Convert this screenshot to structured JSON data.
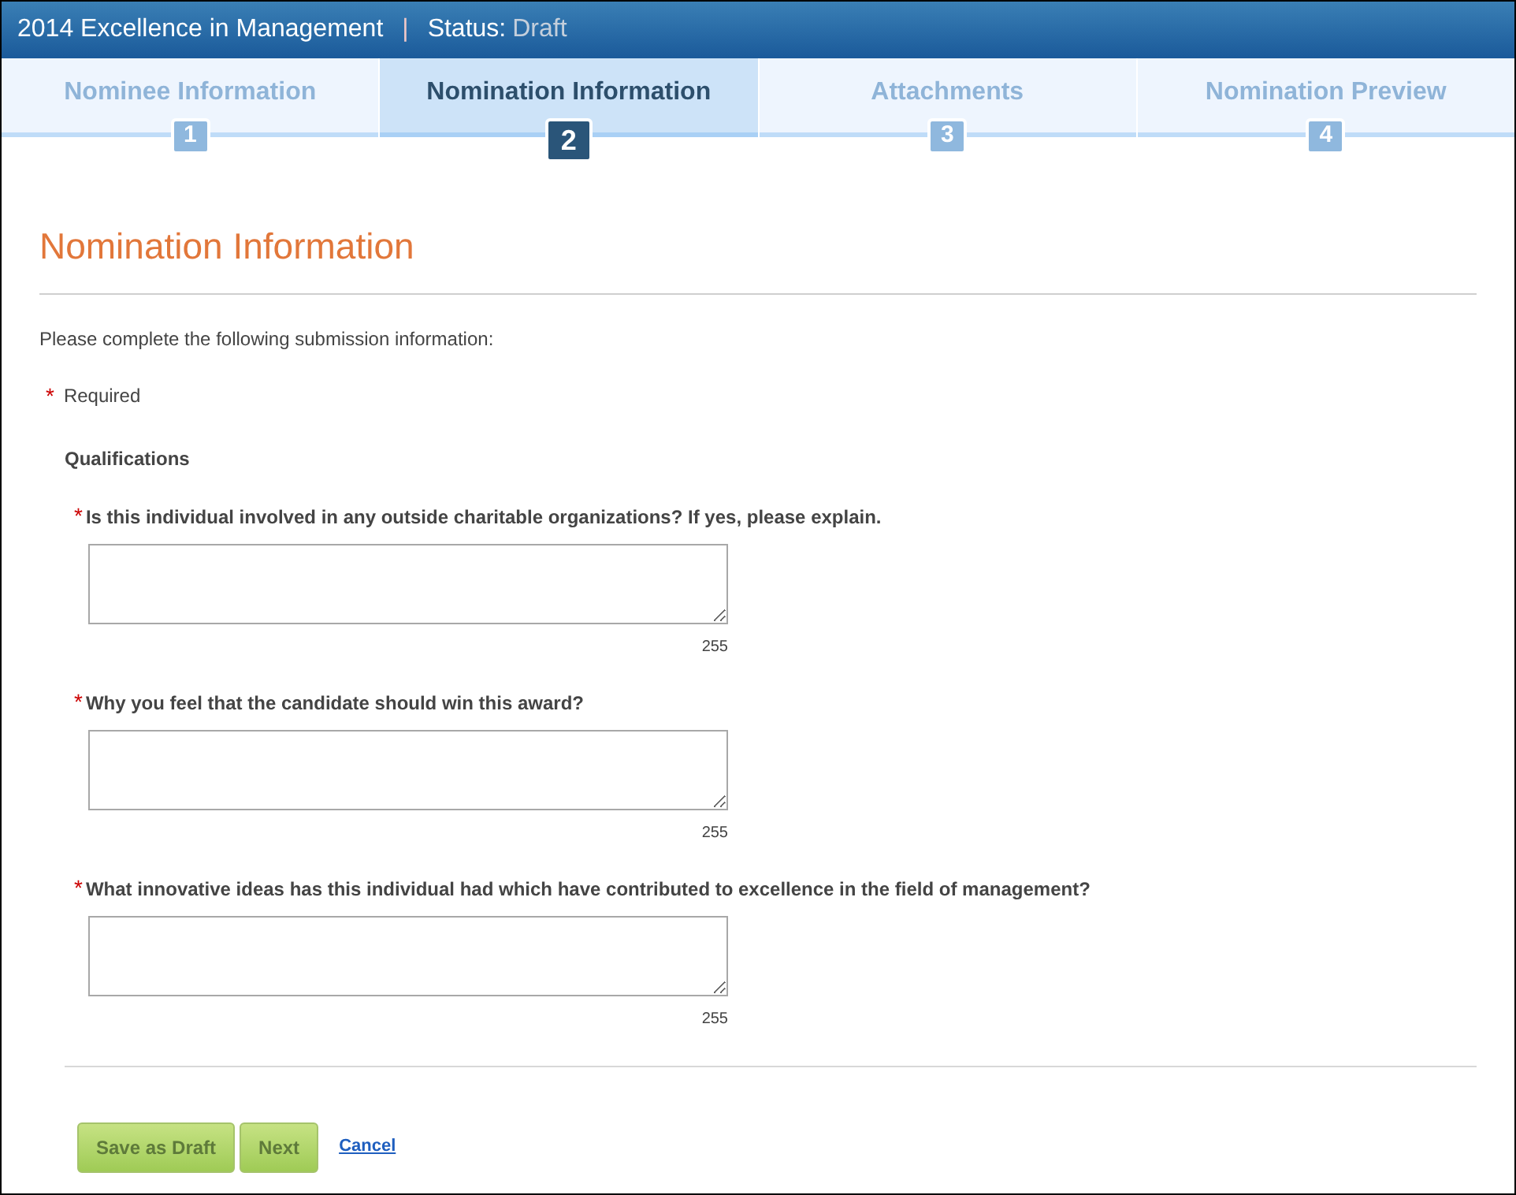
{
  "header": {
    "title": "2014 Excellence in Management",
    "separator": "|",
    "status_label": "Status:",
    "status_value": "Draft"
  },
  "steps": [
    {
      "label": "Nominee Information",
      "number": "1",
      "selected": false
    },
    {
      "label": "Nomination Information",
      "number": "2",
      "selected": true
    },
    {
      "label": "Attachments",
      "number": "3",
      "selected": false
    },
    {
      "label": "Nomination Preview",
      "number": "4",
      "selected": false
    }
  ],
  "page_title": "Nomination Information",
  "intro": "Please complete the following submission information:",
  "required_note": {
    "mark": "*",
    "text": "Required"
  },
  "section_title": "Qualifications",
  "questions": [
    {
      "mark": "*",
      "label": "Is this individual involved in any outside charitable organizations? If yes, please explain.",
      "char_limit": "255"
    },
    {
      "mark": "*",
      "label": "Why you feel that the candidate should win this award?",
      "char_limit": "255"
    },
    {
      "mark": "*",
      "label": "What innovative ideas has this individual had which have contributed to excellence in the field of management?",
      "char_limit": "255"
    }
  ],
  "buttons": [
    {
      "kind": "button",
      "label": "Save as Draft"
    },
    {
      "kind": "button",
      "label": "Next"
    },
    {
      "kind": "link",
      "label": "Cancel"
    }
  ]
}
